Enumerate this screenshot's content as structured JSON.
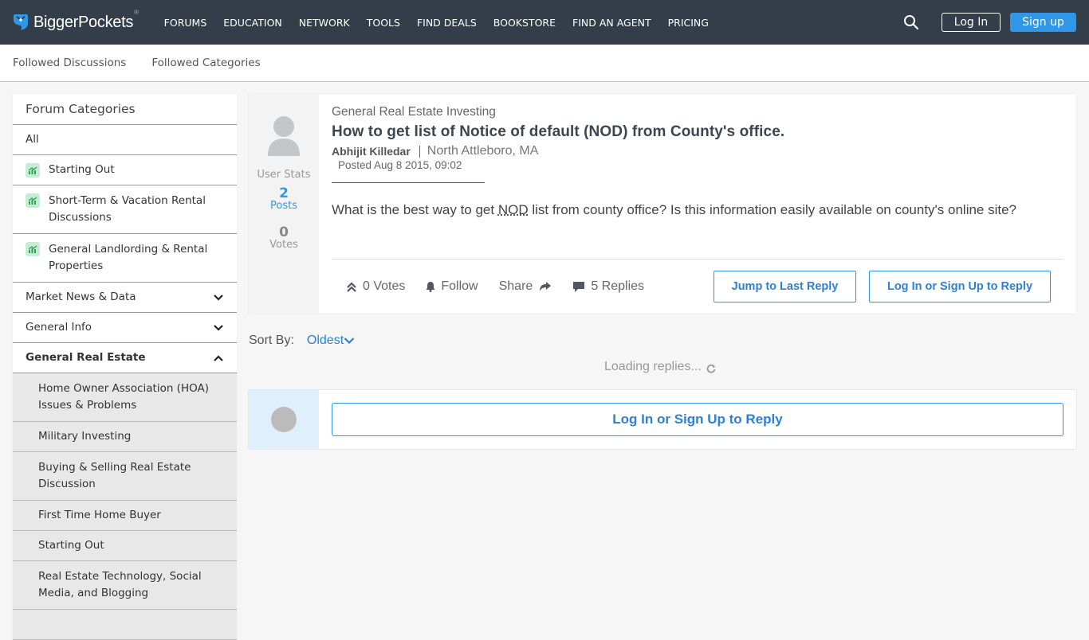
{
  "brand": {
    "name": "BiggerPockets",
    "registered": "®",
    "accent_color": "#2f96e8",
    "nav_bg": "#333e4a"
  },
  "topnav": {
    "links": [
      "FORUMS",
      "EDUCATION",
      "NETWORK",
      "TOOLS",
      "FIND DEALS",
      "BOOKSTORE",
      "FIND AN AGENT",
      "PRICING"
    ],
    "login_label": "Log In",
    "signup_label": "Sign up"
  },
  "subnav": {
    "links": [
      "Followed Discussions",
      "Followed Categories"
    ]
  },
  "sidebar": {
    "title": "Forum Categories",
    "items": [
      {
        "label": "All"
      },
      {
        "label": "Starting Out",
        "icon": "trending-icon"
      },
      {
        "label": "Short-Term & Vacation Rental Discussions",
        "icon": "trending-icon"
      },
      {
        "label": "General Landlording & Rental Properties",
        "icon": "trending-icon"
      },
      {
        "label": "Market News & Data",
        "expand": "chevron-down"
      },
      {
        "label": "General Info",
        "expand": "chevron-down"
      },
      {
        "label": "General Real Estate",
        "expand": "chevron-up",
        "expanded": true
      }
    ],
    "subitems": [
      "Home Owner Association (HOA) Issues & Problems",
      "Military Investing",
      "Buying & Selling Real Estate Discussion",
      "First Time Home Buyer",
      "Starting Out",
      "Real Estate Technology, Social Media, and Blogging"
    ]
  },
  "post": {
    "category": "General Real Estate Investing",
    "title": "How to get list of Notice of default (NOD) from County's office.",
    "author": "Abhijit Killedar",
    "location": "North Attleboro, MA",
    "posted": "Posted Aug 8 2015, 09:02",
    "body_before": "What is the best way to get ",
    "body_abbr": "NOD",
    "body_after": " list from county office? Is this information easily available on county's online site?",
    "user_stats": {
      "label": "User Stats",
      "posts_count": "2",
      "posts_label": "Posts",
      "votes_count": "0",
      "votes_label": "Votes"
    },
    "actions": {
      "votes": "0 Votes",
      "follow": "Follow",
      "share": "Share",
      "replies": "5 Replies"
    },
    "jump_label": "Jump to Last Reply",
    "reply_label": "Log In or Sign Up to Reply"
  },
  "sort": {
    "label": "Sort By:",
    "value": "Oldest"
  },
  "loading_text": "Loading replies...",
  "reply_box": {
    "button_label": "Log In or Sign Up to Reply"
  }
}
